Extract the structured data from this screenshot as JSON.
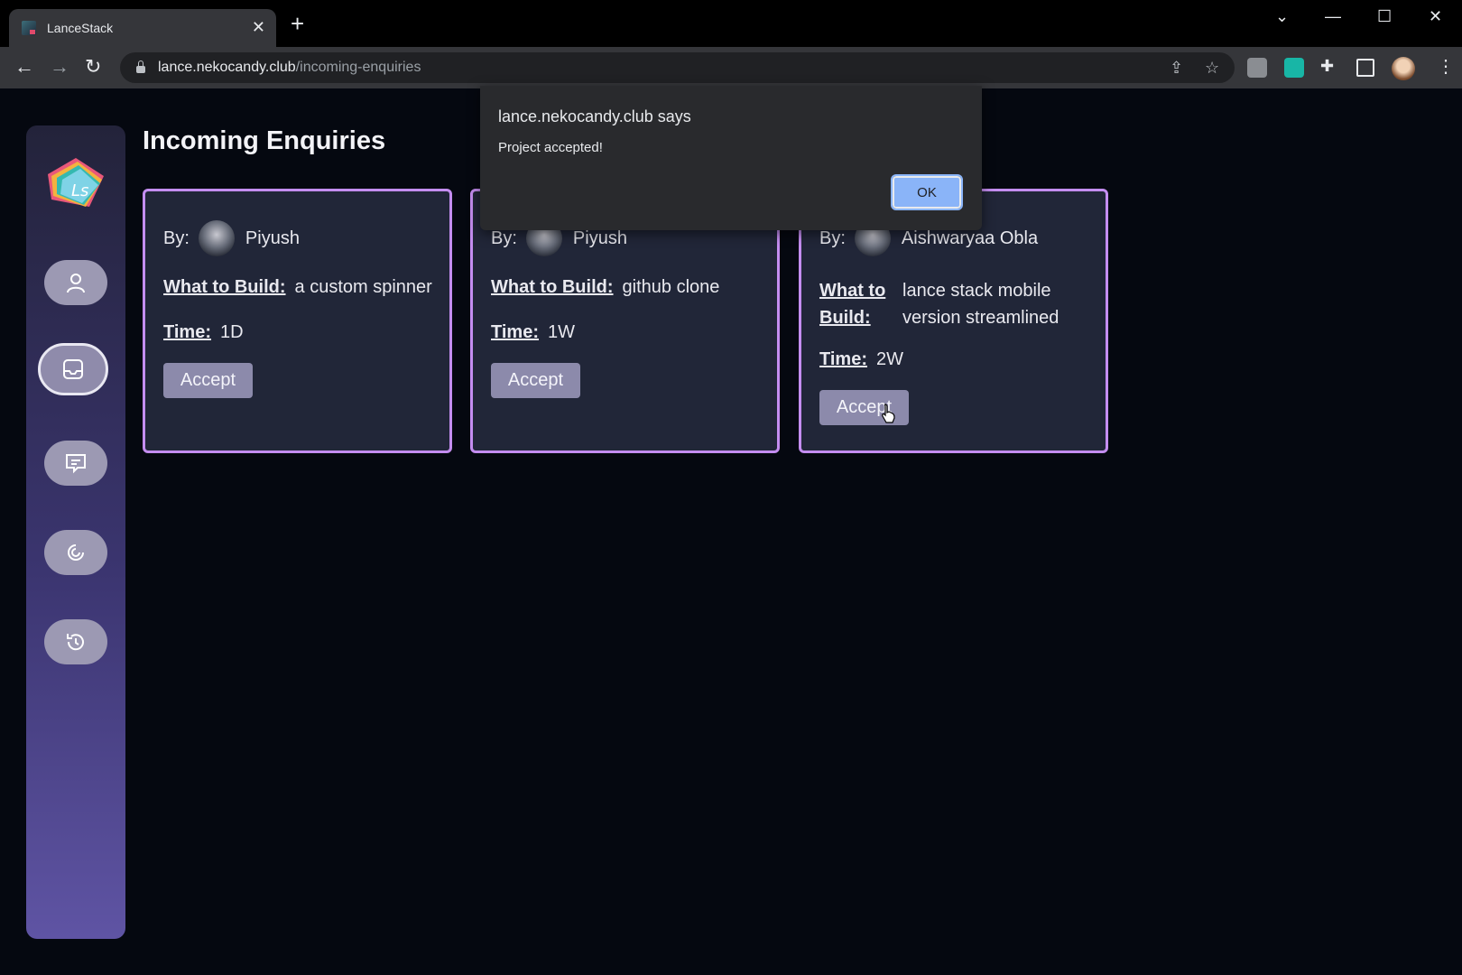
{
  "browser": {
    "tab_title": "LanceStack",
    "tab_close": "✕",
    "new_tab": "+",
    "url_host": "lance.nekocandy.club",
    "url_path": "/incoming-enquiries",
    "window_controls": [
      "⌄",
      "—",
      "☐",
      "✕"
    ]
  },
  "sidebar": {
    "logo_text": "Ls",
    "items": [
      {
        "icon": "user-icon"
      },
      {
        "icon": "inbox-icon",
        "active": true
      },
      {
        "icon": "chat-icon"
      },
      {
        "icon": "sync-icon"
      },
      {
        "icon": "history-icon"
      }
    ]
  },
  "page": {
    "title": "Incoming Enquiries",
    "by_label": "By:",
    "what_label": "What to Build:",
    "what_label_line1": "What to",
    "what_label_line2": "Build:",
    "time_label": "Time:",
    "accept_label": "Accept"
  },
  "enquiries": [
    {
      "name": "Piyush",
      "what": "a custom spinner",
      "time": "1D"
    },
    {
      "name": "Piyush",
      "what": "github clone",
      "time": "1W"
    },
    {
      "name": "Aishwaryaa Obla",
      "what_line1": "lance stack mobile",
      "what_line2": "version streamlined",
      "time": "2W"
    }
  ],
  "dialog": {
    "title": "lance.nekocandy.club says",
    "message": "Project accepted!",
    "ok_label": "OK"
  },
  "colors": {
    "card_border": "#c48df0",
    "card_bg": "#212638",
    "accept_bg": "#8c8aab",
    "ok_bg": "#8ab4f8"
  }
}
